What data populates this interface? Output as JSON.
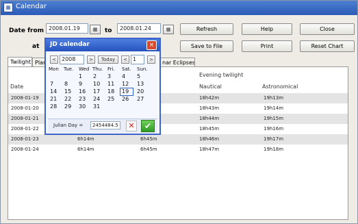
{
  "window": {
    "title": "Calendar"
  },
  "dates": {
    "from_label": "Date from",
    "from_value": "2008.01.19",
    "to_label": "to",
    "to_value": "2008.01.24",
    "at_label": "at"
  },
  "buttons": {
    "refresh": "Refresh",
    "help": "Help",
    "close": "Close",
    "save": "Save to File",
    "print": "Print",
    "reset": "Reset Chart"
  },
  "tabs": [
    {
      "label": "Twilight"
    },
    {
      "label": "Plan"
    },
    {
      "label": "nar Eclipses"
    }
  ],
  "table": {
    "date_header": "Date",
    "evening_header": "Evening twilight",
    "nautical_header": "Nautical",
    "astronomical_header": "Astronomical",
    "rows": [
      {
        "date": "2008-01-19",
        "a": "",
        "b": "",
        "nautical": "18h42m",
        "astro": "19h13m"
      },
      {
        "date": "2008-01-20",
        "a": "",
        "b": "",
        "nautical": "18h43m",
        "astro": "19h14m"
      },
      {
        "date": "2008-01-21",
        "a": "",
        "b": "",
        "nautical": "18h44m",
        "astro": "19h15m"
      },
      {
        "date": "2008-01-22",
        "a": "",
        "b": "",
        "nautical": "18h45m",
        "astro": "19h16m"
      },
      {
        "date": "2008-01-23",
        "a": "6h14m",
        "b": "6h45m",
        "nautical": "18h46m",
        "astro": "19h17m"
      },
      {
        "date": "2008-01-24",
        "a": "6h14m",
        "b": "6h45m",
        "nautical": "18h47m",
        "astro": "19h18m"
      }
    ]
  },
  "jd": {
    "title": "JD calendar",
    "close_glyph": "×",
    "year": "2008",
    "month": "1",
    "prev": "<",
    "next": ">",
    "today": "Today",
    "weekdays": [
      "Mon",
      "Tue.",
      "Wed",
      "Thu.",
      "Fri.",
      "Sat.",
      "Sun."
    ],
    "weeks": [
      [
        "",
        "1",
        "2",
        "3",
        "4",
        "5",
        "6"
      ],
      [
        "7",
        "8",
        "9",
        "10",
        "11",
        "12",
        "13"
      ],
      [
        "14",
        "15",
        "16",
        "17",
        "18",
        "19",
        "20"
      ],
      [
        "21",
        "22",
        "23",
        "24",
        "25",
        "26",
        "27"
      ],
      [
        "28",
        "29",
        "30",
        "31",
        "",
        "",
        ""
      ]
    ],
    "selected_day": "19",
    "julian_label": "Julian Day =",
    "julian_value": "2454484.5",
    "cancel_glyph": "✕",
    "ok_glyph": "✔"
  }
}
